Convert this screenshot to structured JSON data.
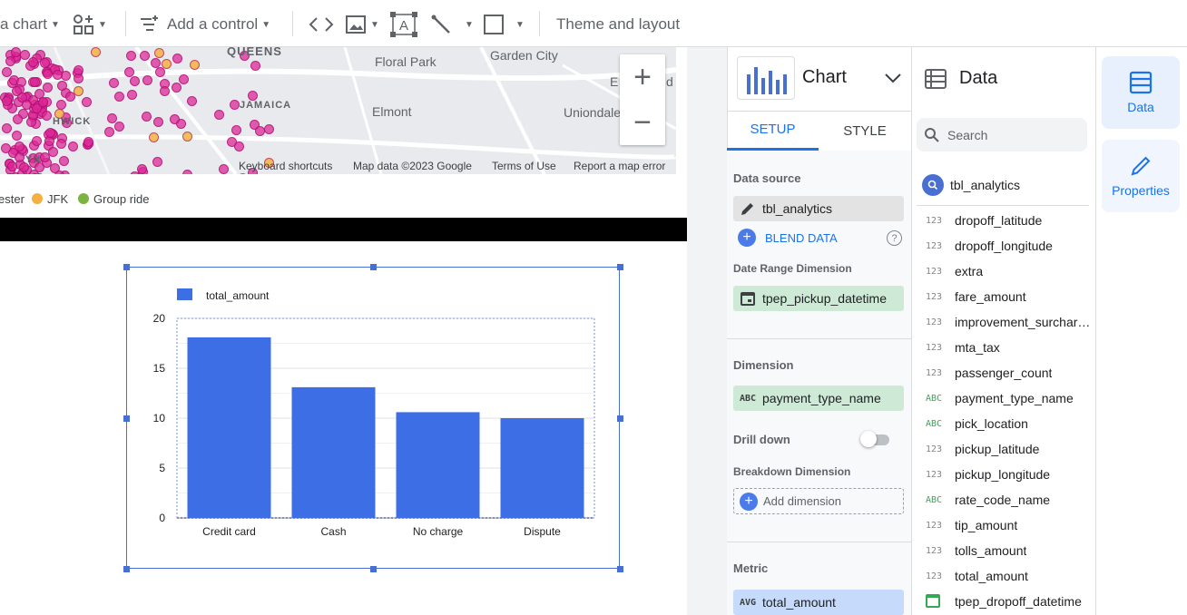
{
  "toolbar": {
    "add_chart": "a chart",
    "add_control": "Add a control",
    "theme_layout": "Theme and layout"
  },
  "map": {
    "labels": [
      "QUEENS",
      "Floral Park",
      "Garden City",
      "JAMAICA",
      "Elmont",
      "Uniondale",
      "HWICK",
      "YN",
      "E",
      "d"
    ],
    "footer": [
      "Keyboard shortcuts",
      "Map data ©2023 Google",
      "Terms of Use",
      "Report a map error"
    ],
    "zoom_in": "+",
    "zoom_out": "−"
  },
  "map_legend": [
    {
      "label": "ester",
      "color": "#e8f0fe"
    },
    {
      "label": "JFK",
      "color": "#f4b042"
    },
    {
      "label": "Group ride",
      "color": "#7cb342"
    }
  ],
  "chart_data": {
    "type": "bar",
    "categories": [
      "Credit card",
      "Cash",
      "No charge",
      "Dispute"
    ],
    "series": [
      {
        "name": "total_amount",
        "values": [
          18.1,
          13.1,
          10.6,
          10.0
        ],
        "color": "#3e6ee5"
      }
    ],
    "ylim": [
      0,
      20
    ],
    "yticks": [
      "0",
      "5",
      "10",
      "15",
      "20"
    ],
    "legend_position": "top-left",
    "grid": true
  },
  "chart_panel": {
    "title": "Chart",
    "tabs": [
      {
        "label": "SETUP",
        "active": true
      },
      {
        "label": "STYLE",
        "active": false
      }
    ],
    "data_source_label": "Data source",
    "data_source": "tbl_analytics",
    "blend_data": "BLEND DATA",
    "date_range_label": "Date Range Dimension",
    "date_range_value": "tpep_pickup_datetime",
    "dimension_label": "Dimension",
    "dimension_type": "ABC",
    "dimension_value": "payment_type_name",
    "drill_down_label": "Drill down",
    "breakdown_label": "Breakdown Dimension",
    "add_dimension": "Add dimension",
    "metric_label": "Metric",
    "metric_agg": "AVG",
    "metric_value": "total_amount"
  },
  "data_panel": {
    "title": "Data",
    "search_placeholder": "Search",
    "source": "tbl_analytics",
    "fields": [
      {
        "type": "123",
        "name": "dropoff_latitude"
      },
      {
        "type": "123",
        "name": "dropoff_longitude"
      },
      {
        "type": "123",
        "name": "extra"
      },
      {
        "type": "123",
        "name": "fare_amount"
      },
      {
        "type": "123",
        "name": "improvement_surcharge"
      },
      {
        "type": "123",
        "name": "mta_tax"
      },
      {
        "type": "123",
        "name": "passenger_count"
      },
      {
        "type": "ABC",
        "name": "payment_type_name"
      },
      {
        "type": "ABC",
        "name": "pick_location"
      },
      {
        "type": "123",
        "name": "pickup_latitude"
      },
      {
        "type": "123",
        "name": "pickup_longitude"
      },
      {
        "type": "ABC",
        "name": "rate_code_name"
      },
      {
        "type": "123",
        "name": "tip_amount"
      },
      {
        "type": "123",
        "name": "tolls_amount"
      },
      {
        "type": "123",
        "name": "total_amount"
      },
      {
        "type": "date",
        "name": "tpep_dropoff_datetime"
      }
    ]
  },
  "side_tabs": [
    {
      "label": "Data",
      "icon": "data-table-icon",
      "active": true
    },
    {
      "label": "Properties",
      "icon": "pencil-icon",
      "active": false
    }
  ]
}
